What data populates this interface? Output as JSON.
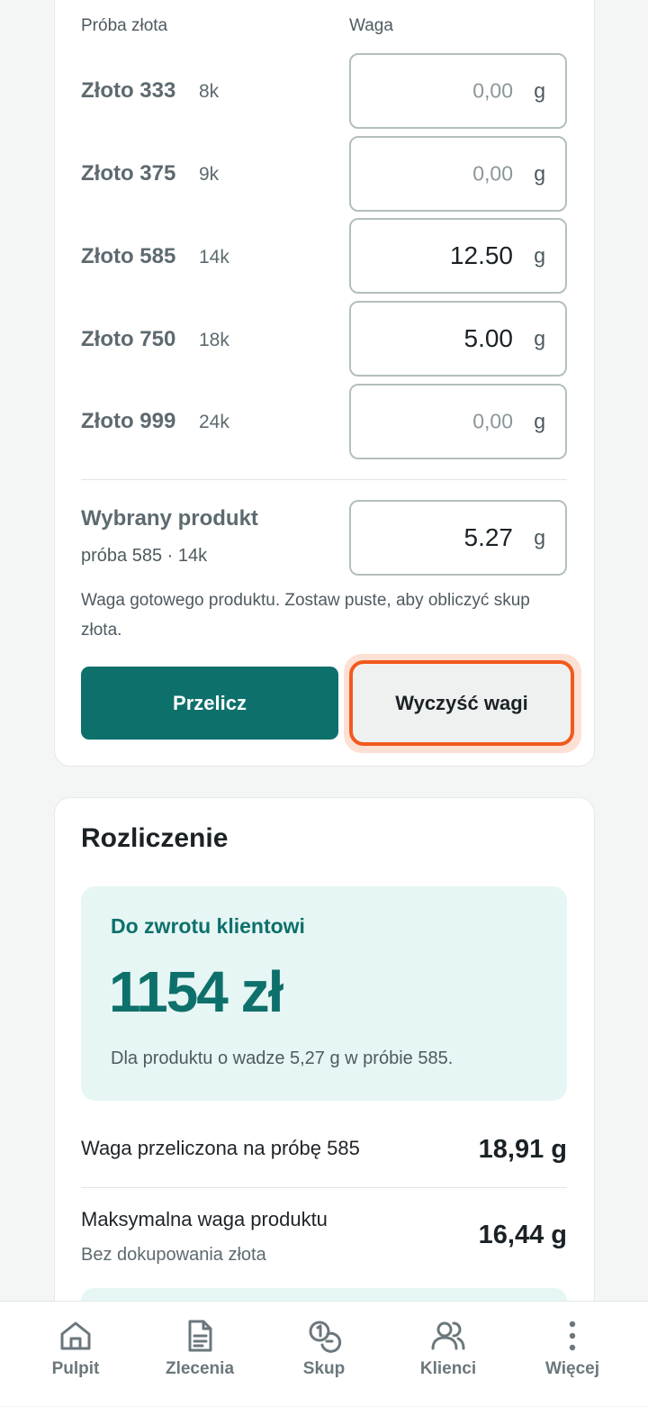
{
  "form": {
    "col_proba": "Próba złota",
    "col_waga": "Waga",
    "rows": [
      {
        "name": "Złoto 333",
        "karat": "8k",
        "value": "0,00",
        "unit": "g"
      },
      {
        "name": "Złoto 375",
        "karat": "9k",
        "value": "0,00",
        "unit": "g"
      },
      {
        "name": "Złoto 585",
        "karat": "14k",
        "value": "12.50",
        "unit": "g"
      },
      {
        "name": "Złoto 750",
        "karat": "18k",
        "value": "5.00",
        "unit": "g"
      },
      {
        "name": "Złoto 999",
        "karat": "24k",
        "value": "0,00",
        "unit": "g"
      }
    ],
    "selected": {
      "title": "Wybrany produkt",
      "subtitle": "próba 585 · 14k",
      "value": "5.27",
      "unit": "g"
    },
    "help": "Waga gotowego produktu. Zostaw puste, aby obliczyć skup złota.",
    "btn_recalc": "Przelicz",
    "btn_clear": "Wyczyść wagi"
  },
  "settlement": {
    "title": "Rozliczenie",
    "refund_label": "Do zwrotu klientowi",
    "refund_amount": "1154 zł",
    "refund_note": "Dla produktu o wadze 5,27 g w próbie 585.",
    "stats": [
      {
        "label": "Waga przeliczona na próbę 585",
        "sub": "",
        "value": "18,91 g"
      },
      {
        "label": "Maksymalna waga produktu",
        "sub": "Bez dokupowania złota",
        "value": "16,44 g"
      }
    ]
  },
  "nav": {
    "items": [
      {
        "label": "Pulpit",
        "icon": "home-icon"
      },
      {
        "label": "Zlecenia",
        "icon": "document-icon"
      },
      {
        "label": "Skup",
        "icon": "coins-icon"
      },
      {
        "label": "Klienci",
        "icon": "users-icon"
      },
      {
        "label": "Więcej",
        "icon": "more-vertical-icon"
      }
    ]
  },
  "colors": {
    "accent": "#0e706b",
    "focus": "#f25a1d",
    "refund_bg": "#e6f6f4"
  }
}
